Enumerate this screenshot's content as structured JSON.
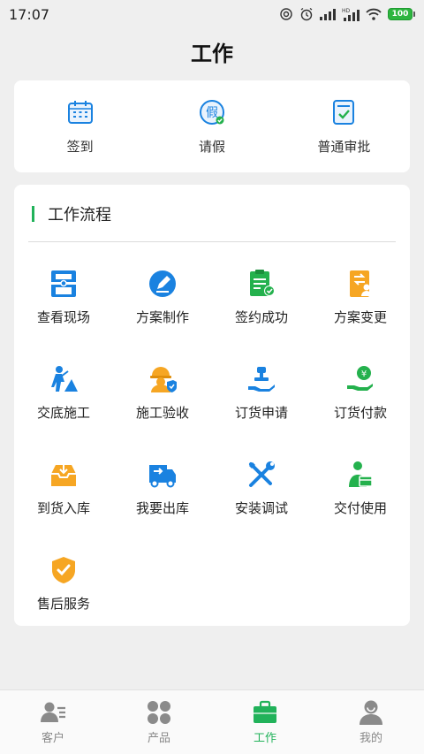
{
  "status": {
    "time": "17:07",
    "battery": "100"
  },
  "page": {
    "title": "工作"
  },
  "quick": [
    {
      "label": "签到",
      "icon": "calendar-icon"
    },
    {
      "label": "请假",
      "icon": "leave-icon"
    },
    {
      "label": "普通审批",
      "icon": "approval-icon"
    }
  ],
  "workflow": {
    "title": "工作流程",
    "items": [
      {
        "label": "查看现场",
        "icon": "site-icon"
      },
      {
        "label": "方案制作",
        "icon": "pen-icon"
      },
      {
        "label": "签约成功",
        "icon": "contract-icon"
      },
      {
        "label": "方案变更",
        "icon": "change-icon"
      },
      {
        "label": "交底施工",
        "icon": "worker-icon"
      },
      {
        "label": "施工验收",
        "icon": "helmet-icon"
      },
      {
        "label": "订货申请",
        "icon": "stamp-icon"
      },
      {
        "label": "订货付款",
        "icon": "payment-icon"
      },
      {
        "label": "到货入库",
        "icon": "inbox-icon"
      },
      {
        "label": "我要出库",
        "icon": "truck-icon"
      },
      {
        "label": "安装调试",
        "icon": "tools-icon"
      },
      {
        "label": "交付使用",
        "icon": "delivery-icon"
      },
      {
        "label": "售后服务",
        "icon": "shield-icon"
      }
    ]
  },
  "tabs": [
    {
      "label": "客户",
      "icon": "customer-icon",
      "active": false
    },
    {
      "label": "产品",
      "icon": "product-icon",
      "active": false
    },
    {
      "label": "工作",
      "icon": "briefcase-icon",
      "active": true
    },
    {
      "label": "我的",
      "icon": "profile-icon",
      "active": false
    }
  ],
  "colors": {
    "accent": "#21b25a",
    "blue": "#1a82e0",
    "orange": "#f6a623",
    "green": "#24b14d"
  }
}
